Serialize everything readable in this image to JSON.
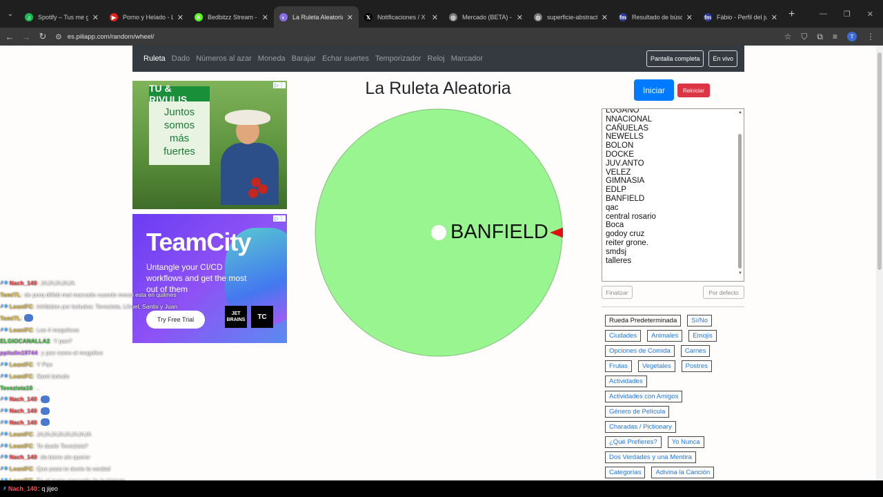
{
  "browser": {
    "tabs": [
      {
        "title": "Spotify – Tus me gusta",
        "color": "#1db954",
        "glyph": "♫"
      },
      {
        "title": "Porno y Helado - Los",
        "color": "#e62117",
        "glyph": "▶"
      },
      {
        "title": "Bedbitzz Stream - Wa",
        "color": "#53fc18",
        "glyph": "K"
      },
      {
        "title": "La Ruleta Aleatoria",
        "color": "#8a6de9",
        "glyph": "◐",
        "active": true
      },
      {
        "title": "Notificaciones / X",
        "color": "#000000",
        "glyph": "𝕏"
      },
      {
        "title": "Mercado (BETA) - Lig",
        "color": "#777777",
        "glyph": "◎"
      },
      {
        "title": "superficie-abstracta-",
        "color": "#777777",
        "glyph": "◎"
      },
      {
        "title": "Resultado de búsque",
        "color": "#2e3a9c",
        "glyph": "fm"
      },
      {
        "title": "Fábio - Perfil del juga",
        "color": "#2e3a9c",
        "glyph": "fm"
      }
    ],
    "url": "es.piliapp.com/random/wheel/"
  },
  "nav": {
    "items": [
      "Ruleta",
      "Dado",
      "Números al azar",
      "Moneda",
      "Barajar",
      "Echar suertes",
      "Temporizador",
      "Reloj",
      "Marcador"
    ],
    "fullscreen": "Pantalla completa",
    "live": "En vivo"
  },
  "ads": {
    "ad1": {
      "brand": "TU & RIVULIS",
      "text": [
        "Juntos",
        "somos",
        "más",
        "fuertes"
      ]
    },
    "ad2": {
      "headline": "TeamCity",
      "sub": "Untangle your CI/CD workflows and get the most out of them",
      "button": "Try Free Trial",
      "logo1": "JET BRAINS",
      "logo2": "TC"
    }
  },
  "page": {
    "title": "La Ruleta Aleatoria",
    "start": "Iniciar",
    "reset": "Reiniciar",
    "finish": "Finalizar",
    "default": "Por defecto"
  },
  "wheel": {
    "winner": "BANFIELD",
    "color": "#99f58f",
    "pointer_color": "#e01010"
  },
  "entries": [
    "LUGANO",
    "NNACIONAL",
    "CAÑUELAS",
    "NEWELLS",
    "BOLON",
    "DOCKE",
    "JUV.ANTO",
    "VELEZ",
    "GIMNASIA",
    "EDLP",
    "BANFIELD",
    "qac",
    "central rosario",
    "Boca",
    "godoy cruz",
    "reiter grone.",
    "smdsj",
    "talleres"
  ],
  "presets": [
    [
      "Rueda Predeterminada",
      "Sí/No"
    ],
    [
      "Ciudades",
      "Animales",
      "Emojis"
    ],
    [
      "Opciones de Comida",
      "Carnes"
    ],
    [
      "Frutas",
      "Vegetales",
      "Postres"
    ],
    [
      "Actividades"
    ],
    [
      "Actividades con Amigos"
    ],
    [
      "Género de Película"
    ],
    [
      "Charadas / Pictionary"
    ],
    [
      "¿Qué Prefieres?",
      "Yo Nunca"
    ],
    [
      "Dos Verdades y una Mentira"
    ],
    [
      "Categorías",
      "Adivina la Canción"
    ]
  ],
  "chat": [
    {
      "name": "Nach_140",
      "color": "#ff4a4a",
      "msg": "JAJAJAJAJA",
      "badge": true
    },
    {
      "name": "TomiTL",
      "color": "#e0c24a",
      "msg": "de porq dfifeb mal marcado cuando messi esta en quilmes"
    },
    {
      "name": "LoaniFC",
      "color": "#e0c24a",
      "msg": "Inhibidos por boludos: Tevezista, Lihuel, Santix y Juan",
      "badge": true
    },
    {
      "name": "TomiTL",
      "color": "#e0c24a",
      "msg": "",
      "emote": true
    },
    {
      "name": "LoaniFC",
      "color": "#e0c24a",
      "msg": "Los 4 mogolicos",
      "badge": true
    },
    {
      "name": "ELGIOCANALLA2",
      "color": "#3fbf3f",
      "msg": "Y pan?"
    },
    {
      "name": "ppitulin19744",
      "color": "#c86bff",
      "msg": "y pan como el mogolico"
    },
    {
      "name": "LoaniFC",
      "color": "#e0c24a",
      "msg": "Y Pan",
      "badge": true
    },
    {
      "name": "LoaniFC",
      "color": "#e0c24a",
      "msg": "Santi boludo",
      "badge": true
    },
    {
      "name": "Tevezista10",
      "color": "#3fbf3f",
      "msg": ".."
    },
    {
      "name": "Nach_140",
      "color": "#ff4a4a",
      "msg": "",
      "emote": true,
      "badge": true
    },
    {
      "name": "Nach_140",
      "color": "#ff4a4a",
      "msg": "",
      "emote": true,
      "badge": true
    },
    {
      "name": "Nach_140",
      "color": "#ff4a4a",
      "msg": "",
      "emote": true,
      "badge": true
    },
    {
      "name": "LoaniFC",
      "color": "#e0c24a",
      "msg": "JAJAJAJAJAJAJAJA",
      "badge": true
    },
    {
      "name": "LoaniFC",
      "color": "#e0c24a",
      "msg": "Te duele Tevezista?",
      "badge": true
    },
    {
      "name": "Nach_140",
      "color": "#ff4a4a",
      "msg": "da borre sin querer",
      "badge": true
    },
    {
      "name": "LoaniFC",
      "color": "#e0c24a",
      "msg": "Que pasa te duele la verdad",
      "badge": true
    },
    {
      "name": "LoaniFC",
      "color": "#e0c24a",
      "msg": "Es el mejor marcado de la historia",
      "badge": true
    }
  ],
  "bottom_chat": {
    "name": "Nach_140",
    "msg": "q jijeo"
  }
}
